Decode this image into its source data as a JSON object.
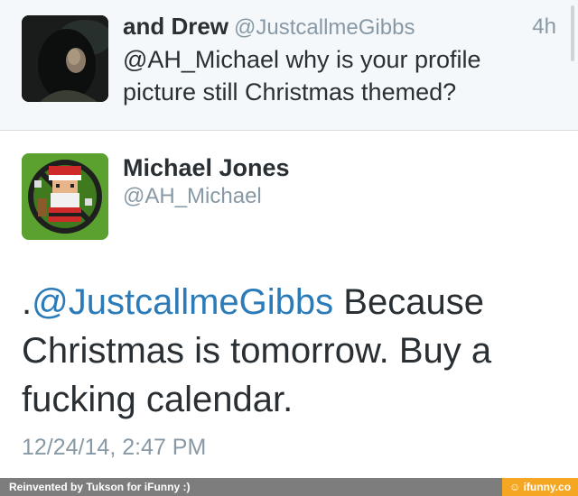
{
  "reply_tweet": {
    "name": "and Drew",
    "handle": "@JustcallmeGibbs",
    "time": "4h",
    "text": "@AH_Michael why is your profile picture still Christmas themed?"
  },
  "main_tweet": {
    "name": "Michael Jones",
    "handle": "@AH_Michael",
    "text_prefix": ".",
    "mention": "@JustcallmeGibbs",
    "text_rest": " Because Christmas is tomorrow. Buy a fucking calendar.",
    "timestamp": "12/24/14, 2:47 PM"
  },
  "footer": {
    "credit": "Reinvented by Tukson for iFunny :)",
    "brand": "ifunny.co"
  },
  "colors": {
    "link": "#2b7bb9",
    "muted": "#8899a6",
    "text": "#292f33",
    "brand": "#f5a623"
  }
}
